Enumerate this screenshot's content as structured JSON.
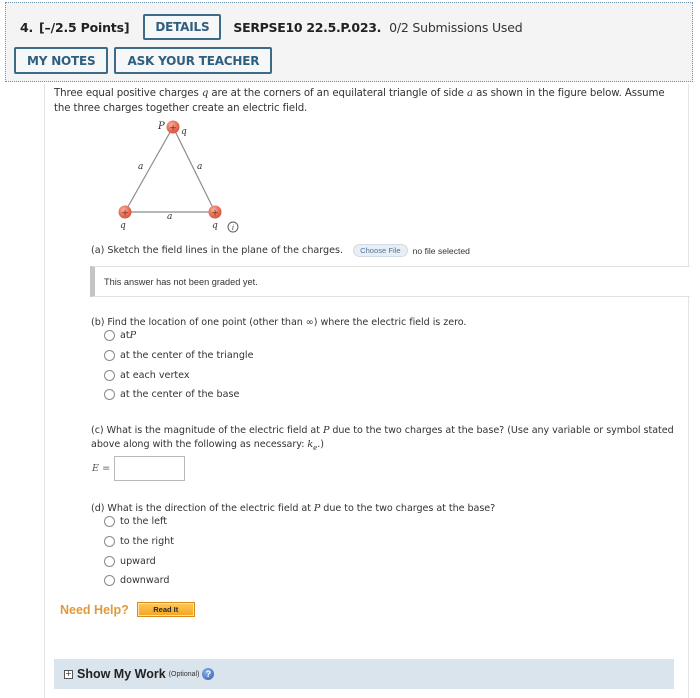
{
  "header": {
    "question_number": "4.",
    "points": "[–/2.5 Points]",
    "details_label": "DETAILS",
    "problem_code": "SERPSE10 22.5.P.023.",
    "submissions": "0/2 Submissions Used",
    "my_notes_label": "MY NOTES",
    "ask_teacher_label": "ASK YOUR TEACHER"
  },
  "intro": {
    "part1": "Three equal positive charges ",
    "var_q": "q",
    "part2": " are at the corners of an equilateral triangle of side ",
    "var_a": "a",
    "part3": " as shown in the figure below. Assume the three charges together create an electric field."
  },
  "figure": {
    "point_label": "P",
    "charge_label": "q",
    "side_label": "a",
    "charge_sign": "+",
    "info_icon": "i",
    "charge_color": "#e8735a",
    "line_color": "#8c8c8c"
  },
  "part_a": {
    "prompt": "(a) Sketch the field lines in the plane of the charges.",
    "choose_file_label": "Choose File",
    "file_status": "no file selected",
    "graded_message": "This answer has not been graded yet."
  },
  "part_b": {
    "prompt_pre": "(b) Find the location of one point (other than ∞) where the electric field is zero.",
    "options": [
      {
        "label_pre": "at ",
        "label_var": "P"
      },
      {
        "label_pre": "at the center of the triangle",
        "label_var": ""
      },
      {
        "label_pre": "at each vertex",
        "label_var": ""
      },
      {
        "label_pre": "at the center of the base",
        "label_var": ""
      }
    ]
  },
  "part_c": {
    "prompt_pre": "(c) What is the magnitude of the electric field at ",
    "prompt_var": "P",
    "prompt_post": " due to the two charges at the base? (Use any variable or symbol stated above along with the following as necessary: ",
    "ke_k": "k",
    "ke_sub": "e",
    "prompt_end": ".)",
    "answer_label_var": "E",
    "answer_label_eq": " =",
    "answer_value": ""
  },
  "part_d": {
    "prompt_pre": "(d) What is the direction of the electric field at ",
    "prompt_var": "P",
    "prompt_post": " due to the two charges at the base?",
    "options": [
      "to the left",
      "to the right",
      "upward",
      "downward"
    ]
  },
  "help": {
    "need_help_label": "Need Help?",
    "read_it_label": "Read It"
  },
  "show_work": {
    "expand_icon": "+",
    "title": "Show My Work",
    "optional": "(Optional)",
    "help_icon": "?"
  },
  "colors": {
    "button_border": "#3d6a86",
    "need_help": "#e09a3c",
    "read_it": "#f4a31c",
    "show_work_bg": "#dae4ec"
  }
}
